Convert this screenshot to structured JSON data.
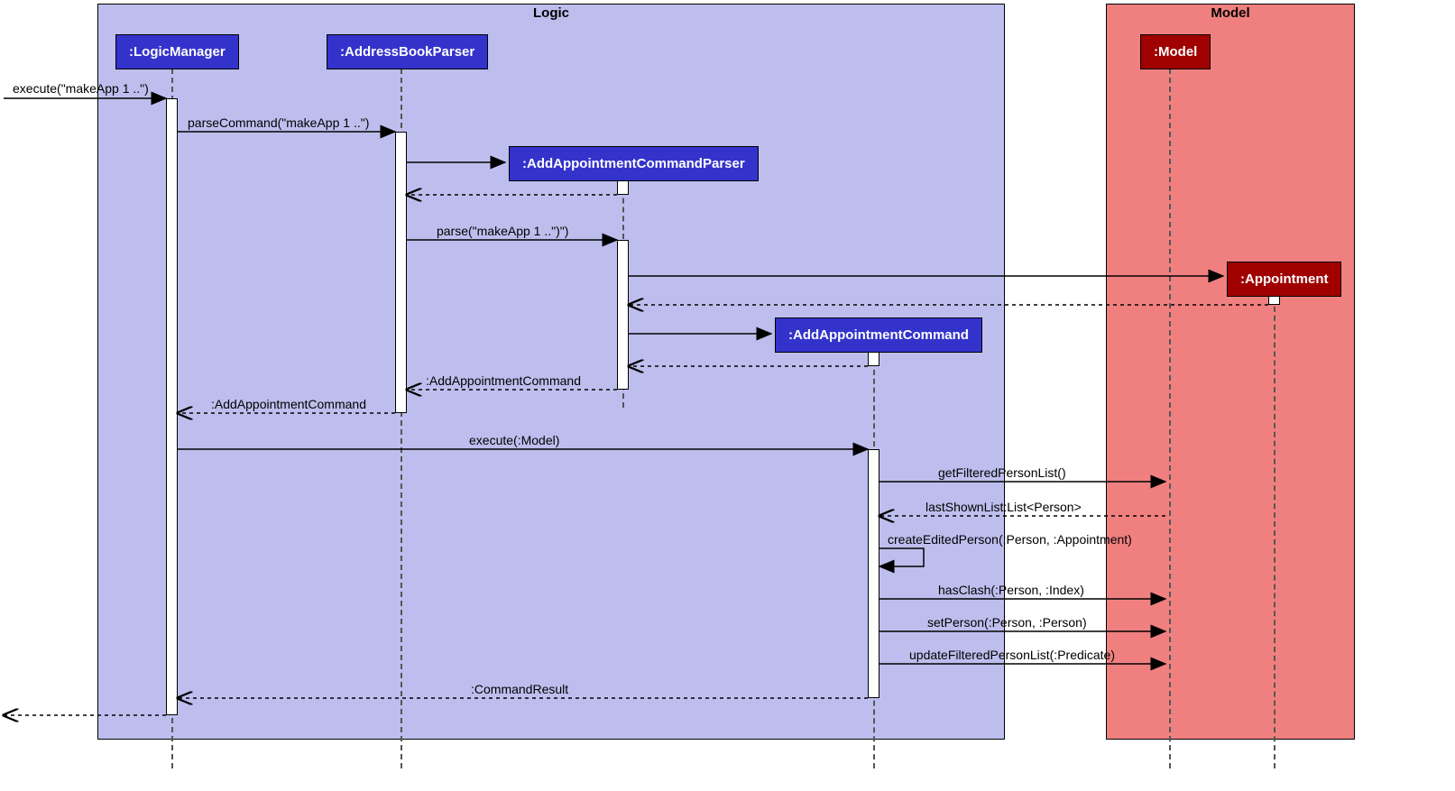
{
  "frames": {
    "logic": {
      "label": "Logic"
    },
    "model": {
      "label": "Model"
    }
  },
  "participants": {
    "logic_manager": ":LogicManager",
    "address_book_parser": ":AddressBookParser",
    "add_appt_cmd_parser": ":AddAppointmentCommandParser",
    "add_appt_cmd": ":AddAppointmentCommand",
    "model": ":Model",
    "appointment": ":Appointment"
  },
  "messages": {
    "m0": "execute(\"makeApp 1 ..\")",
    "m1": "parseCommand(\"makeApp 1 ..\")",
    "m2": "parse(\"makeApp 1 ..\")\")",
    "m3": ":AddAppointmentCommand",
    "m4": ":AddAppointmentCommand",
    "m5": "execute(:Model)",
    "m6": "getFilteredPersonList()",
    "m7": "lastShownList:List<Person>",
    "m8": "createEditedPerson(:Person, :Appointment)",
    "m9": "hasClash(:Person, :Index)",
    "m10": "setPerson(:Person, :Person)",
    "m11": "updateFilteredPersonList(:Predicate)",
    "m12": ":CommandResult"
  }
}
